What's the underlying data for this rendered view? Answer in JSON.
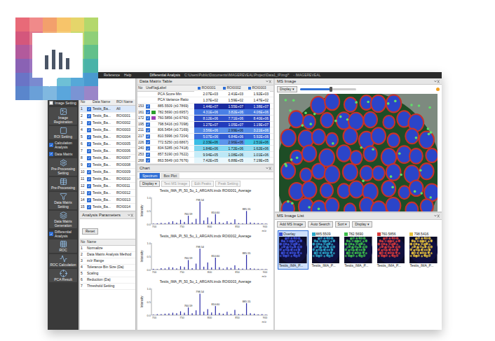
{
  "window": {
    "menu": [
      "Reference",
      "Help"
    ],
    "mode": "Differential Analysis",
    "path": "C:\\Users\\Public\\Documents\\IMAGEREVEAL\\Project\\Data1_IP.imgl*",
    "app": "- IMAGEREVEAL"
  },
  "toolbar": [
    {
      "kind": "group",
      "label": "Image Setting",
      "checked": false
    },
    {
      "kind": "button",
      "label": "Image Registration"
    },
    {
      "kind": "button",
      "label": "ROI Setting"
    },
    {
      "kind": "group",
      "label": "Calculation Analysis",
      "checked": true
    },
    {
      "kind": "group",
      "label": "Data Matrix",
      "checked": true
    },
    {
      "kind": "button",
      "label": "Pre-Processing Setting"
    },
    {
      "kind": "button",
      "label": "Pre-Processing"
    },
    {
      "kind": "button",
      "label": "Data Matrix Setting"
    },
    {
      "kind": "button",
      "label": "Data Matrix Generation"
    },
    {
      "kind": "group",
      "label": "Differential Analysis",
      "checked": true
    },
    {
      "kind": "button",
      "label": "ROC"
    },
    {
      "kind": "button",
      "label": "ROC Calculation"
    },
    {
      "kind": "button",
      "label": "PCA Result"
    }
  ],
  "file_list": {
    "columns": [
      "No",
      "",
      "Data Name",
      "ROI Name"
    ],
    "rows": [
      {
        "num": "1",
        "checked": true,
        "data": "Testis_Ba...",
        "roi": "All"
      },
      {
        "num": "2",
        "checked": true,
        "data": "Testis_Ba...",
        "roi": "ROI0001"
      },
      {
        "num": "3",
        "checked": true,
        "data": "Testis_Ba...",
        "roi": "ROI0002"
      },
      {
        "num": "4",
        "checked": true,
        "data": "Testis_Ba...",
        "roi": "ROI0003"
      },
      {
        "num": "5",
        "checked": true,
        "data": "Testis_Ba...",
        "roi": "ROI0004"
      },
      {
        "num": "6",
        "checked": true,
        "data": "Testis_Ba...",
        "roi": "ROI0005"
      },
      {
        "num": "7",
        "checked": true,
        "data": "Testis_Ba...",
        "roi": "ROI0006"
      },
      {
        "num": "8",
        "checked": true,
        "data": "Testis_Ba...",
        "roi": "ROI0007"
      },
      {
        "num": "9",
        "checked": true,
        "data": "Testis_Ba...",
        "roi": "ROI0008"
      },
      {
        "num": "10",
        "checked": true,
        "data": "Testis_Ba...",
        "roi": "ROI0009"
      },
      {
        "num": "11",
        "checked": true,
        "data": "Testis_Ba...",
        "roi": "ROI0010"
      },
      {
        "num": "12",
        "checked": true,
        "data": "Testis_Ba...",
        "roi": "ROI0011"
      },
      {
        "num": "13",
        "checked": true,
        "data": "Testis_Ba...",
        "roi": "ROI0012"
      },
      {
        "num": "14",
        "checked": true,
        "data": "Testis_Ba...",
        "roi": "ROI0013"
      },
      {
        "num": "15",
        "checked": true,
        "data": "Testis_Ba...",
        "roi": "ROI0014"
      }
    ]
  },
  "analysis_parameters": {
    "title": "Analysis Parameters",
    "reset": "Reset",
    "columns": [
      "No",
      "Name"
    ],
    "rows": [
      {
        "no": "1",
        "name": "Normalize"
      },
      {
        "no": "2",
        "name": "Data Matrix Analysis Method"
      },
      {
        "no": "3",
        "name": "m/z Range"
      },
      {
        "no": "4",
        "name": "Tolerance Bin Size (Da)"
      },
      {
        "no": "5",
        "name": "Scaling"
      },
      {
        "no": "6",
        "name": "Reduction (Da)"
      },
      {
        "no": "7",
        "name": "Threshold Setting"
      }
    ]
  },
  "data_matrix": {
    "title": "Data Matrix Table",
    "columns": [
      "No",
      "Use",
      "Flag",
      "Label",
      "ROI0001",
      "ROI0002",
      "ROI0003"
    ],
    "rows": [
      {
        "no": "",
        "use": false,
        "flagged": false,
        "label": "PCA Score Min",
        "cells": [
          {
            "value": "2.07E+03",
            "color": "#ffffff"
          },
          {
            "value": "2.41E+03",
            "color": "#ffffff"
          },
          {
            "value": "1.92E+03",
            "color": "#ffffff"
          }
        ]
      },
      {
        "no": "",
        "use": false,
        "flagged": false,
        "label": "PCA Variance Ratio",
        "cells": [
          {
            "value": "1.37E+02",
            "color": "#ffffff"
          },
          {
            "value": "1.59E+02",
            "color": "#ffffff"
          },
          {
            "value": "1.47E+02",
            "color": "#ffffff"
          }
        ]
      },
      {
        "no": "153",
        "use": true,
        "flagged": false,
        "label": "885.5509 (±0.7869)",
        "cells": [
          {
            "value": "1.44E+07",
            "color": "#1d2fa8"
          },
          {
            "value": "1.55E+07",
            "color": "#1a2a9c"
          },
          {
            "value": "1.38E+07",
            "color": "#2038b4"
          }
        ]
      },
      {
        "no": "161",
        "use": true,
        "flagged": true,
        "color": "#2ca02c",
        "label": "782.5690 (±0.6957)",
        "cells": [
          {
            "value": "4.31E+06",
            "color": "#3f73e0"
          },
          {
            "value": "3.82E+06",
            "color": "#4a80e6"
          },
          {
            "value": "4.06E+06",
            "color": "#4477e2"
          }
        ]
      },
      {
        "no": "172",
        "use": true,
        "flagged": true,
        "color": "#9b3fb5",
        "label": "760.5856 (±0.6760)",
        "cells": [
          {
            "value": "8.12E+06",
            "color": "#2a4cc8"
          },
          {
            "value": "7.71E+06",
            "color": "#2d50cc"
          },
          {
            "value": "8.40E+06",
            "color": "#2848c4"
          }
        ]
      },
      {
        "no": "195",
        "use": true,
        "flagged": false,
        "label": "798.5416 (±0.7098)",
        "cells": [
          {
            "value": "1.27E+07",
            "color": "#2035b0"
          },
          {
            "value": "1.05E+07",
            "color": "#233cbc"
          },
          {
            "value": "1.19E+07",
            "color": "#2138b4"
          }
        ]
      },
      {
        "no": "211",
        "use": true,
        "flagged": false,
        "label": "806.5454 (±0.7169)",
        "cells": [
          {
            "value": "3.56E+06",
            "color": "#4f86e8"
          },
          {
            "value": "2.99E+06",
            "color": "#5b93ec"
          },
          {
            "value": "3.21E+06",
            "color": "#568dea"
          }
        ]
      },
      {
        "no": "217",
        "use": true,
        "flagged": false,
        "label": "810.5996 (±0.7204)",
        "cells": [
          {
            "value": "5.07E+06",
            "color": "#3a6cdc"
          },
          {
            "value": "6.84E+06",
            "color": "#2f58d0"
          },
          {
            "value": "5.92E+06",
            "color": "#3462d6"
          }
        ]
      },
      {
        "no": "226",
        "use": true,
        "flagged": false,
        "label": "772.5250 (±0.6867)",
        "cells": [
          {
            "value": "2.33E+06",
            "color": "#39bde6"
          },
          {
            "value": "2.96E+06",
            "color": "#5c94ec"
          },
          {
            "value": "2.51E+06",
            "color": "#3fc4e8"
          }
        ]
      },
      {
        "no": "240",
        "use": true,
        "flagged": false,
        "label": "834.5285 (±0.7418)",
        "cells": [
          {
            "value": "1.84E+06",
            "color": "#7fd6f0"
          },
          {
            "value": "1.72E+06",
            "color": "#86d9f2"
          },
          {
            "value": "1.62E+06",
            "color": "#8edcf2"
          }
        ]
      },
      {
        "no": "253",
        "use": true,
        "flagged": false,
        "label": "857.5190 (±0.7622)",
        "cells": [
          {
            "value": "9.94E+05",
            "color": "#c6ecf8"
          },
          {
            "value": "1.08E+06",
            "color": "#bce8f6"
          },
          {
            "value": "1.01E+06",
            "color": "#c2eaf8"
          }
        ]
      },
      {
        "no": "268",
        "use": true,
        "flagged": false,
        "label": "863.5649 (±0.7676)",
        "cells": [
          {
            "value": "7.42E+05",
            "color": "#e4f5fb"
          },
          {
            "value": "6.88E+05",
            "color": "#eaf7fc"
          },
          {
            "value": "7.19E+05",
            "color": "#e6f6fb"
          }
        ]
      }
    ]
  },
  "chart": {
    "title": "Chart",
    "tabs": [
      {
        "label": "Spectrum",
        "selected": true
      },
      {
        "label": "Box Plot",
        "selected": false
      }
    ],
    "tools": [
      {
        "label": "Display ▾",
        "disabled": false
      },
      {
        "label": "Text MS Image",
        "disabled": true
      },
      {
        "label": "Edit Peaks",
        "disabled": true
      },
      {
        "label": "Peak Setting",
        "disabled": true
      }
    ],
    "y_label": "Intensity",
    "x_label": "m/z",
    "x_ticks": [
      "700",
      "750",
      "800",
      "850",
      "900"
    ],
    "y_ticks": [
      "0.0",
      "0.5",
      "1.0"
    ],
    "spectra": [
      {
        "title": "Testis_IMA_Pl_50_5u_1_ARGAIN.imdx ROI0001_Average",
        "values": [
          0.02,
          0.03,
          0.05,
          0.04,
          0.08,
          0.12,
          0.06,
          0.18,
          0.09,
          0.35,
          0.07,
          0.22,
          0.95,
          0.15,
          0.28,
          0.1,
          0.42,
          0.08,
          0.05,
          0.12,
          0.06,
          0.2,
          0.04,
          0.03,
          0.55,
          0.07,
          0.05,
          0.04,
          0.03,
          0.02
        ],
        "peaks": [
          {
            "at": 9,
            "label": "760.59"
          },
          {
            "at": 12,
            "label": "798.54"
          },
          {
            "at": 16,
            "label": "810.60"
          },
          {
            "at": 24,
            "label": "885.55"
          }
        ]
      },
      {
        "title": "Testis_IMA_Pl_50_5u_1_ARGAIN.imdx ROI0002_Average",
        "values": [
          0.03,
          0.02,
          0.06,
          0.05,
          0.1,
          0.09,
          0.05,
          0.14,
          0.11,
          0.4,
          0.06,
          0.25,
          0.88,
          0.12,
          0.3,
          0.09,
          0.5,
          0.1,
          0.04,
          0.1,
          0.07,
          0.18,
          0.05,
          0.04,
          0.62,
          0.06,
          0.04,
          0.03,
          0.02,
          0.02
        ],
        "peaks": [
          {
            "at": 9,
            "label": "760.59"
          },
          {
            "at": 12,
            "label": "798.54"
          },
          {
            "at": 16,
            "label": "810.60"
          },
          {
            "at": 24,
            "label": "885.55"
          }
        ]
      },
      {
        "title": "Testis_IMA_Pl_50_5u_1_ARGAIN.imdx ROI0003_Average",
        "values": [
          0.02,
          0.04,
          0.04,
          0.06,
          0.07,
          0.1,
          0.08,
          0.16,
          0.1,
          0.32,
          0.08,
          0.2,
          0.9,
          0.14,
          0.25,
          0.11,
          0.38,
          0.09,
          0.06,
          0.14,
          0.05,
          0.22,
          0.04,
          0.05,
          0.5,
          0.08,
          0.06,
          0.03,
          0.04,
          0.02
        ],
        "peaks": [
          {
            "at": 9,
            "label": "760.59"
          },
          {
            "at": 12,
            "label": "798.54"
          },
          {
            "at": 16,
            "label": "810.60"
          },
          {
            "at": 24,
            "label": "885.55"
          }
        ]
      }
    ]
  },
  "ms_image": {
    "title": "MS Image",
    "display": "Display ▾",
    "slider": {
      "level": 0.55
    }
  },
  "ms_image_list": {
    "title": "MS Image List",
    "tools": [
      "Add MS Image",
      "Auto Search",
      "Sort ▾",
      "Display ▾"
    ],
    "items": [
      {
        "label": "Overlay",
        "color": "#3a4fd8",
        "name": "Testis_IMA_P...",
        "selected": true
      },
      {
        "label": "885.5509",
        "color": "#2aa7c9",
        "name": "Testis_IMA_P...",
        "selected": false
      },
      {
        "label": "782.5690",
        "color": "#3cbf4a",
        "name": "Testis_IMA_P...",
        "selected": false
      },
      {
        "label": "760.5856",
        "color": "#d83a3a",
        "name": "Testis_IMA_P...",
        "selected": false
      },
      {
        "label": "798.5416",
        "color": "#e8c23a",
        "name": "Testis_IMA_P...",
        "selected": false
      }
    ]
  }
}
